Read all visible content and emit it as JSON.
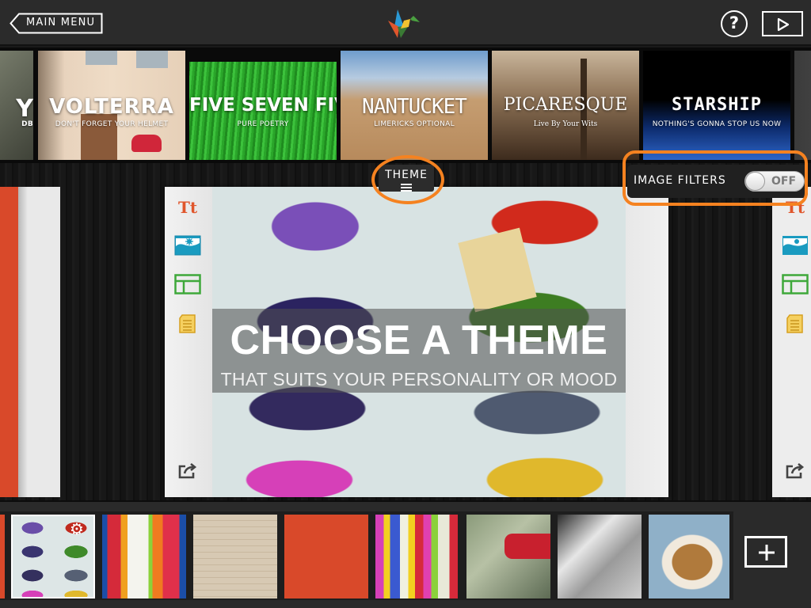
{
  "topbar": {
    "main_menu_label": "MAIN MENU",
    "help_label": "?",
    "logo_icon": "origami-bird-logo",
    "play_icon": "play-icon"
  },
  "themes": [
    {
      "title": "Y",
      "subtitle": "DB"
    },
    {
      "title": "VOLTERRA",
      "subtitle": "DON'T FORGET YOUR HELMET"
    },
    {
      "title": "FIVE SEVEN FIVE",
      "subtitle": "PURE POETRY"
    },
    {
      "title": "NANTUCKET",
      "subtitle": "LIMERICKS OPTIONAL"
    },
    {
      "title": "PICARESQUE",
      "subtitle": "Live By Your Wits"
    },
    {
      "title": "STARSHIP",
      "subtitle": "NOTHING'S GONNA STOP US NOW"
    }
  ],
  "theme_tab": {
    "label": "THEME"
  },
  "image_filters": {
    "label": "IMAGE FILTERS",
    "state": "OFF",
    "enabled": false
  },
  "page": {
    "caption_title": "CHOOSE A THEME",
    "caption_subtitle": "THAT SUITS YOUR PERSONALITY OR MOOD",
    "tools": [
      {
        "name": "text-tool",
        "glyph": "Tt",
        "color": "#e0562c"
      },
      {
        "name": "image-tool",
        "color": "#1a9bc0"
      },
      {
        "name": "layout-tool",
        "color": "#3ea83a"
      },
      {
        "name": "notes-tool",
        "color": "#e0b030"
      },
      {
        "name": "share-tool",
        "color": "#444444"
      }
    ]
  },
  "bottom_strip": {
    "selected_index": 1,
    "settings_glyph": "⚙",
    "add_icon": "plus-icon"
  },
  "colors": {
    "highlight": "#f58220",
    "accent_orange": "#d9492a"
  }
}
